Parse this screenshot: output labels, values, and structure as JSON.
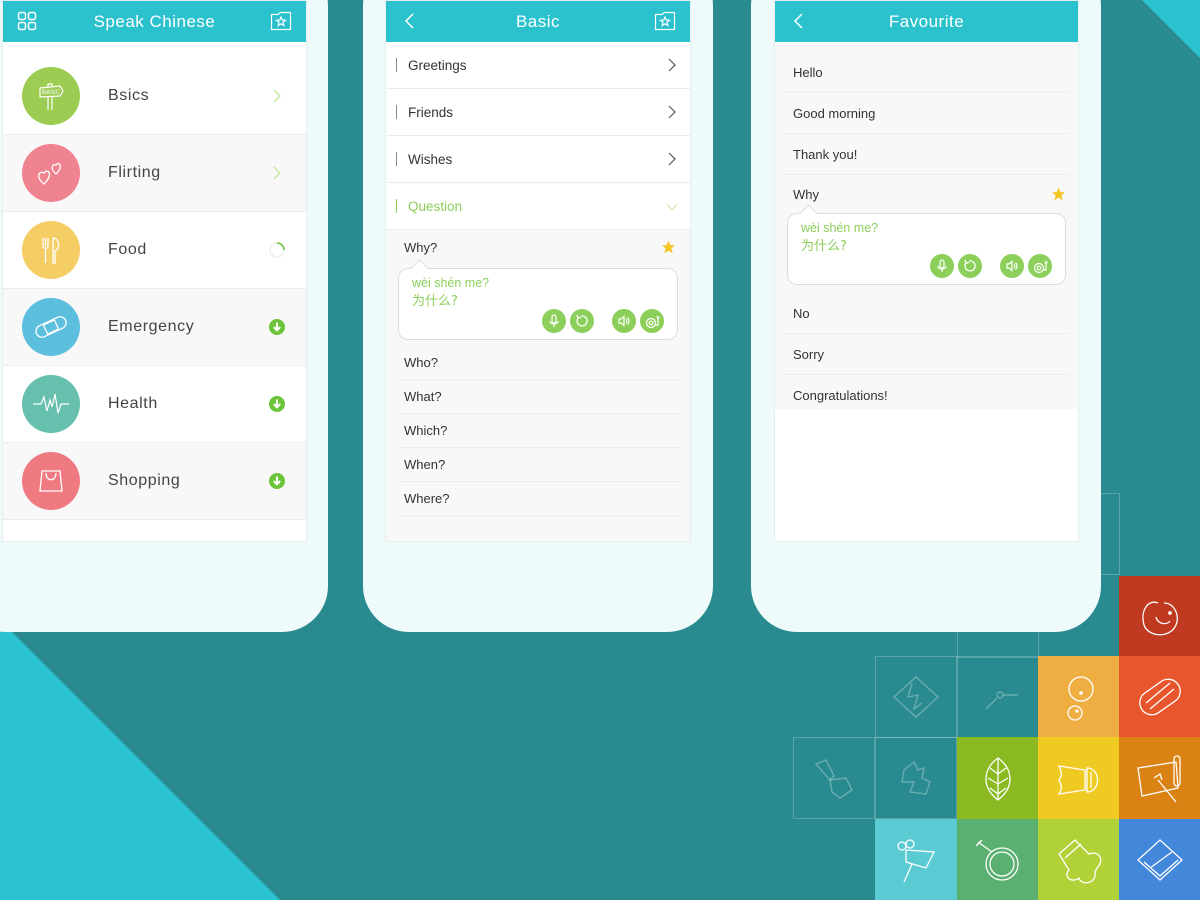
{
  "colors": {
    "background": "#298a8f",
    "accent": "#2bc1cd",
    "green": "#8ccf5a",
    "star": "#f5c623"
  },
  "screen1": {
    "title": "Speak Chinese",
    "left_icon": "grid-menu-icon",
    "right_icon": "favourite-folder-icon",
    "categories": [
      {
        "label": "Bsics",
        "icon": "basic-signpost-icon",
        "color": "#9ccc52",
        "status": "chevron"
      },
      {
        "label": "Flirting",
        "icon": "hearts-icon",
        "color": "#ef8390",
        "status": "chevron"
      },
      {
        "label": "Food",
        "icon": "fork-knife-icon",
        "color": "#f4cd65",
        "status": "loading"
      },
      {
        "label": "Emergency",
        "icon": "bandage-icon",
        "color": "#5cbfde",
        "status": "download"
      },
      {
        "label": "Health",
        "icon": "heartbeat-icon",
        "color": "#66c0ad",
        "status": "download"
      },
      {
        "label": "Shopping",
        "icon": "shopping-bag-icon",
        "color": "#ef7a82",
        "status": "download"
      }
    ]
  },
  "screen2": {
    "title": "Basic",
    "left_icon": "back-chevron-icon",
    "right_icon": "favourite-folder-icon",
    "sections": [
      {
        "label": "Greetings",
        "state": "collapsed"
      },
      {
        "label": "Friends",
        "state": "collapsed"
      },
      {
        "label": "Wishes",
        "state": "collapsed"
      },
      {
        "label": "Question",
        "state": "expanded"
      }
    ],
    "expanded_phrase": {
      "text": "Why?",
      "pinyin": "wèi shén me?",
      "hanzi": "为什么?",
      "starred": true
    },
    "phrases": [
      "Who?",
      "What?",
      "Which?",
      "When?",
      "Where?"
    ]
  },
  "screen3": {
    "title": "Favourite",
    "left_icon": "back-chevron-icon",
    "phrases_before": [
      "Hello",
      "Good morning",
      "Thank you!"
    ],
    "expanded_phrase": {
      "text": "Why",
      "pinyin": "wèi shén me?",
      "hanzi": "为什么?",
      "starred": true
    },
    "phrases_after": [
      "No",
      "Sorry",
      "Congratulations!"
    ]
  },
  "audio_controls": [
    "record-mic-icon",
    "replay-icon",
    "speaker-icon",
    "slow-snail-icon"
  ],
  "tiles": [
    {
      "icon": "chick-icon",
      "color": "#c03a22"
    },
    {
      "icon": "peach-icon",
      "color": "#efae42"
    },
    {
      "icon": "hotdog-icon",
      "color": "#e8562e"
    },
    {
      "icon": "leaf-icon",
      "color": "#8ab921"
    },
    {
      "icon": "shuttlecock-icon",
      "color": "#efca22"
    },
    {
      "icon": "scroll-brush-icon",
      "color": "#da8213"
    },
    {
      "icon": "purse-icon",
      "color": "#5acbd2"
    },
    {
      "icon": "mirror-icon",
      "color": "#5ab070"
    },
    {
      "icon": "mitten-icon",
      "color": "#b0d138"
    },
    {
      "icon": "book-icon",
      "color": "#4287d9"
    }
  ]
}
